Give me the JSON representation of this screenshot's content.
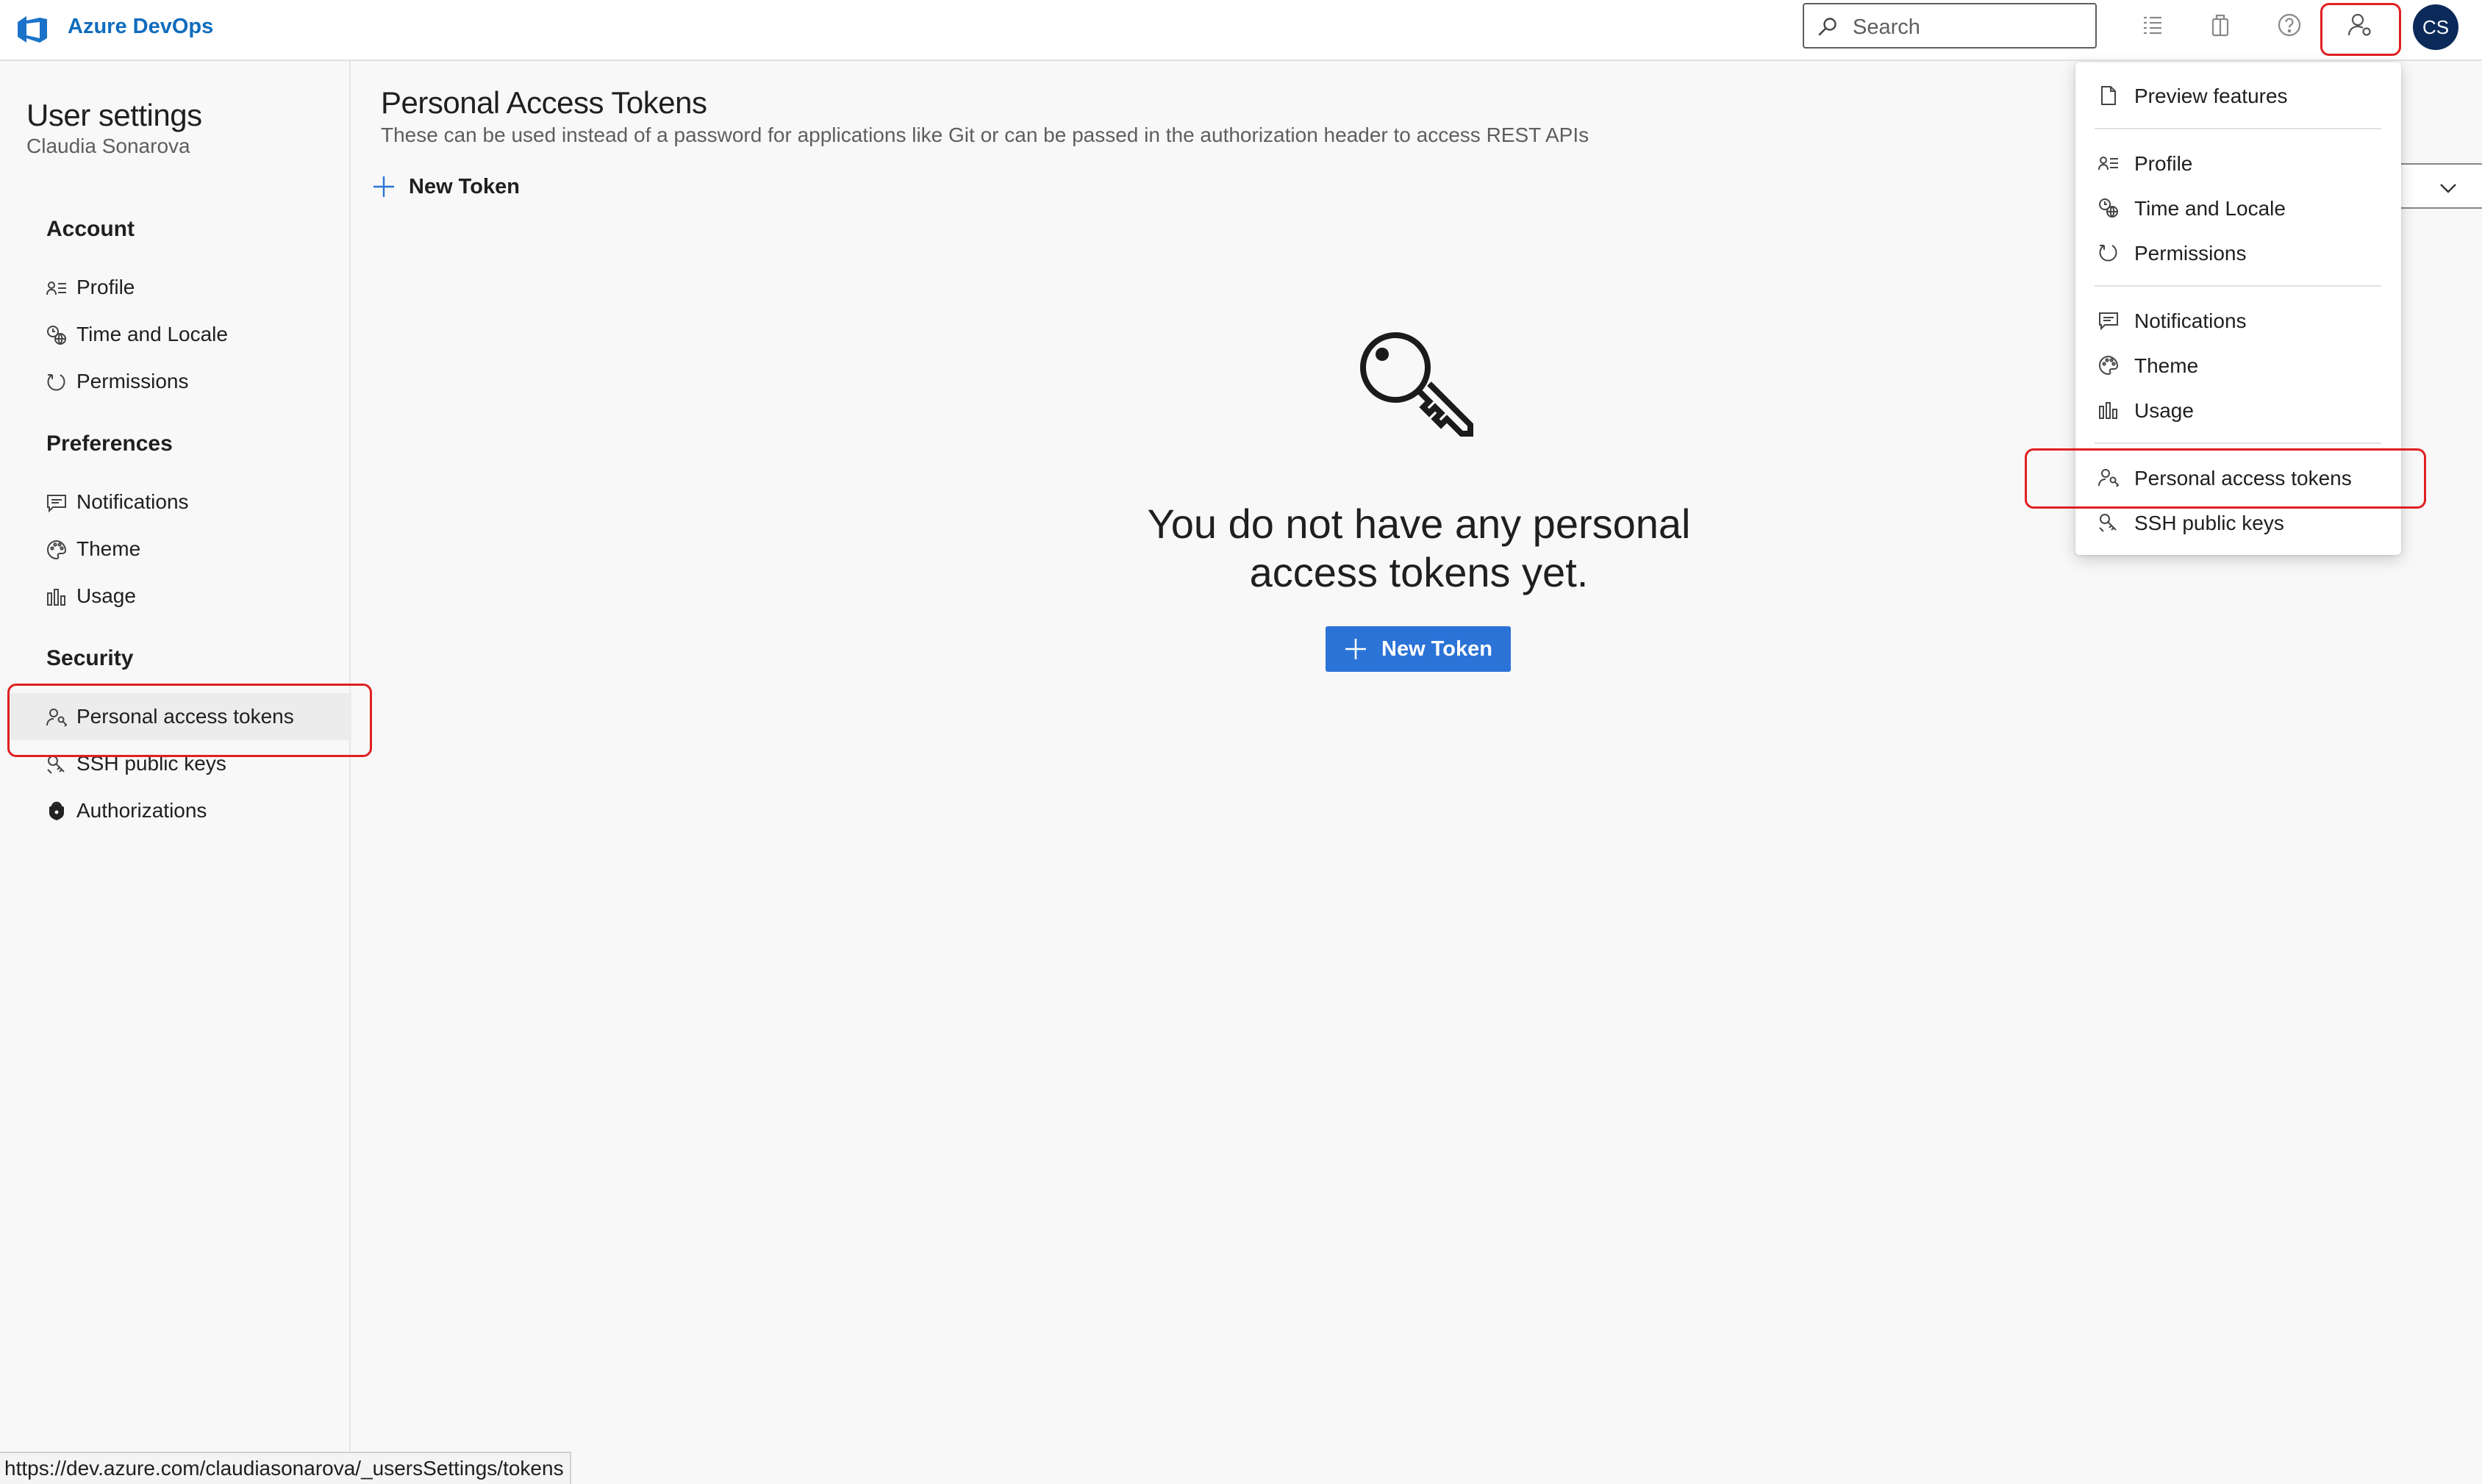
{
  "header": {
    "brand": "Azure DevOps",
    "search_placeholder": "Search",
    "avatar_initials": "CS",
    "icons": [
      "search-icon",
      "task-list-icon",
      "marketplace-bag-icon",
      "help-icon",
      "user-settings-icon"
    ]
  },
  "sidebar": {
    "title": "User settings",
    "user_name": "Claudia Sonarova",
    "sections": [
      {
        "heading": "Account",
        "items": [
          {
            "label": "Profile",
            "icon": "profile-icon"
          },
          {
            "label": "Time and Locale",
            "icon": "globe-clock-icon"
          },
          {
            "label": "Permissions",
            "icon": "permissions-icon"
          }
        ]
      },
      {
        "heading": "Preferences",
        "items": [
          {
            "label": "Notifications",
            "icon": "chat-bubble-icon"
          },
          {
            "label": "Theme",
            "icon": "palette-icon"
          },
          {
            "label": "Usage",
            "icon": "bar-chart-icon"
          }
        ]
      },
      {
        "heading": "Security",
        "items": [
          {
            "label": "Personal access tokens",
            "icon": "person-key-icon",
            "selected": true
          },
          {
            "label": "SSH public keys",
            "icon": "ssh-key-icon"
          },
          {
            "label": "Authorizations",
            "icon": "lock-icon"
          }
        ]
      }
    ]
  },
  "main": {
    "title": "Personal Access Tokens",
    "description": "These can be used instead of a password for applications like Git or can be passed in the authorization header to access REST APIs",
    "new_token_label": "New Token",
    "empty_message_line1": "You do not have any personal",
    "empty_message_line2": "access tokens yet.",
    "primary_button_label": "New Token"
  },
  "menu": {
    "items": [
      {
        "label": "Preview features",
        "icon": "document-icon"
      },
      {
        "label": "Profile",
        "icon": "profile-icon"
      },
      {
        "label": "Time and Locale",
        "icon": "globe-clock-icon"
      },
      {
        "label": "Permissions",
        "icon": "permissions-icon"
      },
      {
        "label": "Notifications",
        "icon": "chat-bubble-icon"
      },
      {
        "label": "Theme",
        "icon": "palette-icon"
      },
      {
        "label": "Usage",
        "icon": "bar-chart-icon"
      },
      {
        "label": "Personal access tokens",
        "icon": "person-key-icon"
      },
      {
        "label": "SSH public keys",
        "icon": "ssh-key-icon"
      }
    ]
  },
  "status_bar": {
    "url": "https://dev.azure.com/claudiasonarova/_usersSettings/tokens"
  },
  "colors": {
    "accent": "#2b73d6",
    "brand": "#0f6cbd",
    "highlight": "#e02020",
    "avatar_bg": "#0b2a5a"
  }
}
